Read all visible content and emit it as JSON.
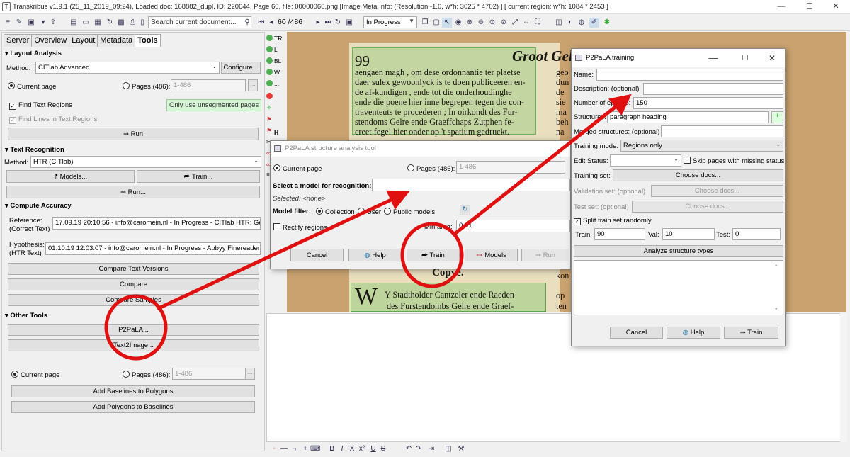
{
  "app": {
    "title": "Transkribus v1.9.1 (25_11_2019_09:24), Loaded doc: 168882_dupl, ID: 220644, Page 60, file: 00000060.png [Image Meta Info: (Resolution:-1.0, w*h: 3025 * 4702) ] [ current region: w*h: 1084 * 2453 ]",
    "icon_letter": "T"
  },
  "toolbar": {
    "search_placeholder": "Search current document...",
    "page_current": "60",
    "page_total": "/486",
    "status_value": "In Progress"
  },
  "left_panel": {
    "tabs": [
      "Server",
      "Overview",
      "Layout",
      "Metadata",
      "Tools"
    ],
    "active_tab": "Tools",
    "layout_analysis": {
      "header": "Layout Analysis",
      "method_label": "Method:",
      "method_value": "CITlab Advanced",
      "configure_label": "Configure...",
      "current_page_label": "Current page",
      "pages_label": "Pages (486):",
      "pages_range": "1-486",
      "find_text_regions": "Find Text Regions",
      "find_lines": "Find Lines in Text Regions",
      "only_unsegmented": "Only use unsegmented pages",
      "run_label": "⇒ Run"
    },
    "text_recognition": {
      "header": "Text Recognition",
      "method_label": "Method:",
      "method_value": "HTR (CITlab)",
      "models_label": "Models...",
      "train_label": "Train...",
      "run_label": "Run..."
    },
    "compute_accuracy": {
      "header": "Compute Accuracy",
      "reference_label": "Reference:",
      "reference_sub": "(Correct Text)",
      "reference_value": "17.09.19 20:10:56 - info@caromein.nl - In Progress - CITlab HTR: Gelde",
      "hypothesis_label": "Hypothesis:",
      "hypothesis_sub": "(HTR Text)",
      "hypothesis_value": "01.10.19 12:03:07 - info@caromein.nl - In Progress - Abbyy Finereader 11",
      "compare_versions": "Compare Text Versions",
      "compare": "Compare",
      "compare_samples": "Compare Samples"
    },
    "other_tools": {
      "header": "Other Tools",
      "p2pala": "P2PaLA...",
      "text2image": "Text2Image...",
      "current_page_label": "Current page",
      "pages_label": "Pages (486):",
      "pages_range": "1-486",
      "baselines_to_polygons": "Add Baselines to Polygons",
      "polygons_to_baselines": "Add Polygons to Baselines",
      "ellipsis": "..."
    }
  },
  "layer_strip": {
    "items": [
      "TR",
      "L",
      "BL",
      "W",
      "..."
    ],
    "h_label": "H"
  },
  "document": {
    "page_number": "99",
    "header_text": "Groot Gel",
    "lines": [
      "aengaen magh , om dese ordonnantie ter plaetse",
      "daer sulex gewoonlyck is te doen publiceeren en-",
      "de af-kundigen , ende tot die onderhoudinghe",
      "ende die poene hier inne begrepen tegen die con-",
      "traventeuts te procederen ; In oirkondt des Fur-",
      "stendoms Gelre ende Graeffchaps Zutphen fe-",
      "creet fegel hier onder op 't spatium gedruckt."
    ],
    "right_col": [
      "geo",
      "dun",
      "de",
      "sie",
      "ma",
      "beh",
      "na",
      "kon",
      "op",
      "ten"
    ],
    "copy_label": "Copye.",
    "bottom_line1": "Y  Stadtholder  Cantzeler  ende  Raeden",
    "bottom_line2": "des  Furstendombs  Gelre  ende  Graef-",
    "drop_cap": "W"
  },
  "structure_dialog": {
    "title": "P2PaLA structure analysis tool",
    "current_page_label": "Current page",
    "pages_label": "Pages (486):",
    "pages_range": "1-486",
    "select_model_label": "Select a model for recognition:",
    "selected_label": "Selected: <none>",
    "model_filter_label": "Model filter:",
    "filter_collection": "Collection",
    "filter_user": "User",
    "filter_public": "Public models",
    "rectify_label": "Rectify regions",
    "min_area_label": "Min area:",
    "min_area_value": "0.01",
    "cancel": "Cancel",
    "help": "Help",
    "train": "Train",
    "models": "Models",
    "run": "Run"
  },
  "training_dialog": {
    "title": "P2PaLA training",
    "name_label": "Name:",
    "description_label": "Description: (optional)",
    "epochs_label": "Number of epochs:",
    "epochs_value": "150",
    "structures_label": "Structures:",
    "structures_value": "paragraph heading",
    "merged_label": "Merged structures: (optional)",
    "training_mode_label": "Training mode:",
    "training_mode_value": "Regions only",
    "edit_status_label": "Edit Status:",
    "skip_pages_label": "Skip pages with missing status",
    "training_set_label": "Training set:",
    "validation_set_label": "Validation set: (optional)",
    "test_set_label": "Test set: (optional)",
    "choose_docs": "Choose docs...",
    "split_label": "Split train set randomly",
    "train_label": "Train:",
    "train_value": "90",
    "val_label": "Val:",
    "val_value": "10",
    "test_label": "Test:",
    "test_value": "0",
    "analyze_label": "Analyze structure types",
    "cancel": "Cancel",
    "help": "Help",
    "train": "Train"
  },
  "bottom_toolbar": {
    "items": [
      "B",
      "I",
      "X",
      "x²",
      "x₂",
      "U",
      "S"
    ]
  },
  "annotation_color": "#e01010"
}
